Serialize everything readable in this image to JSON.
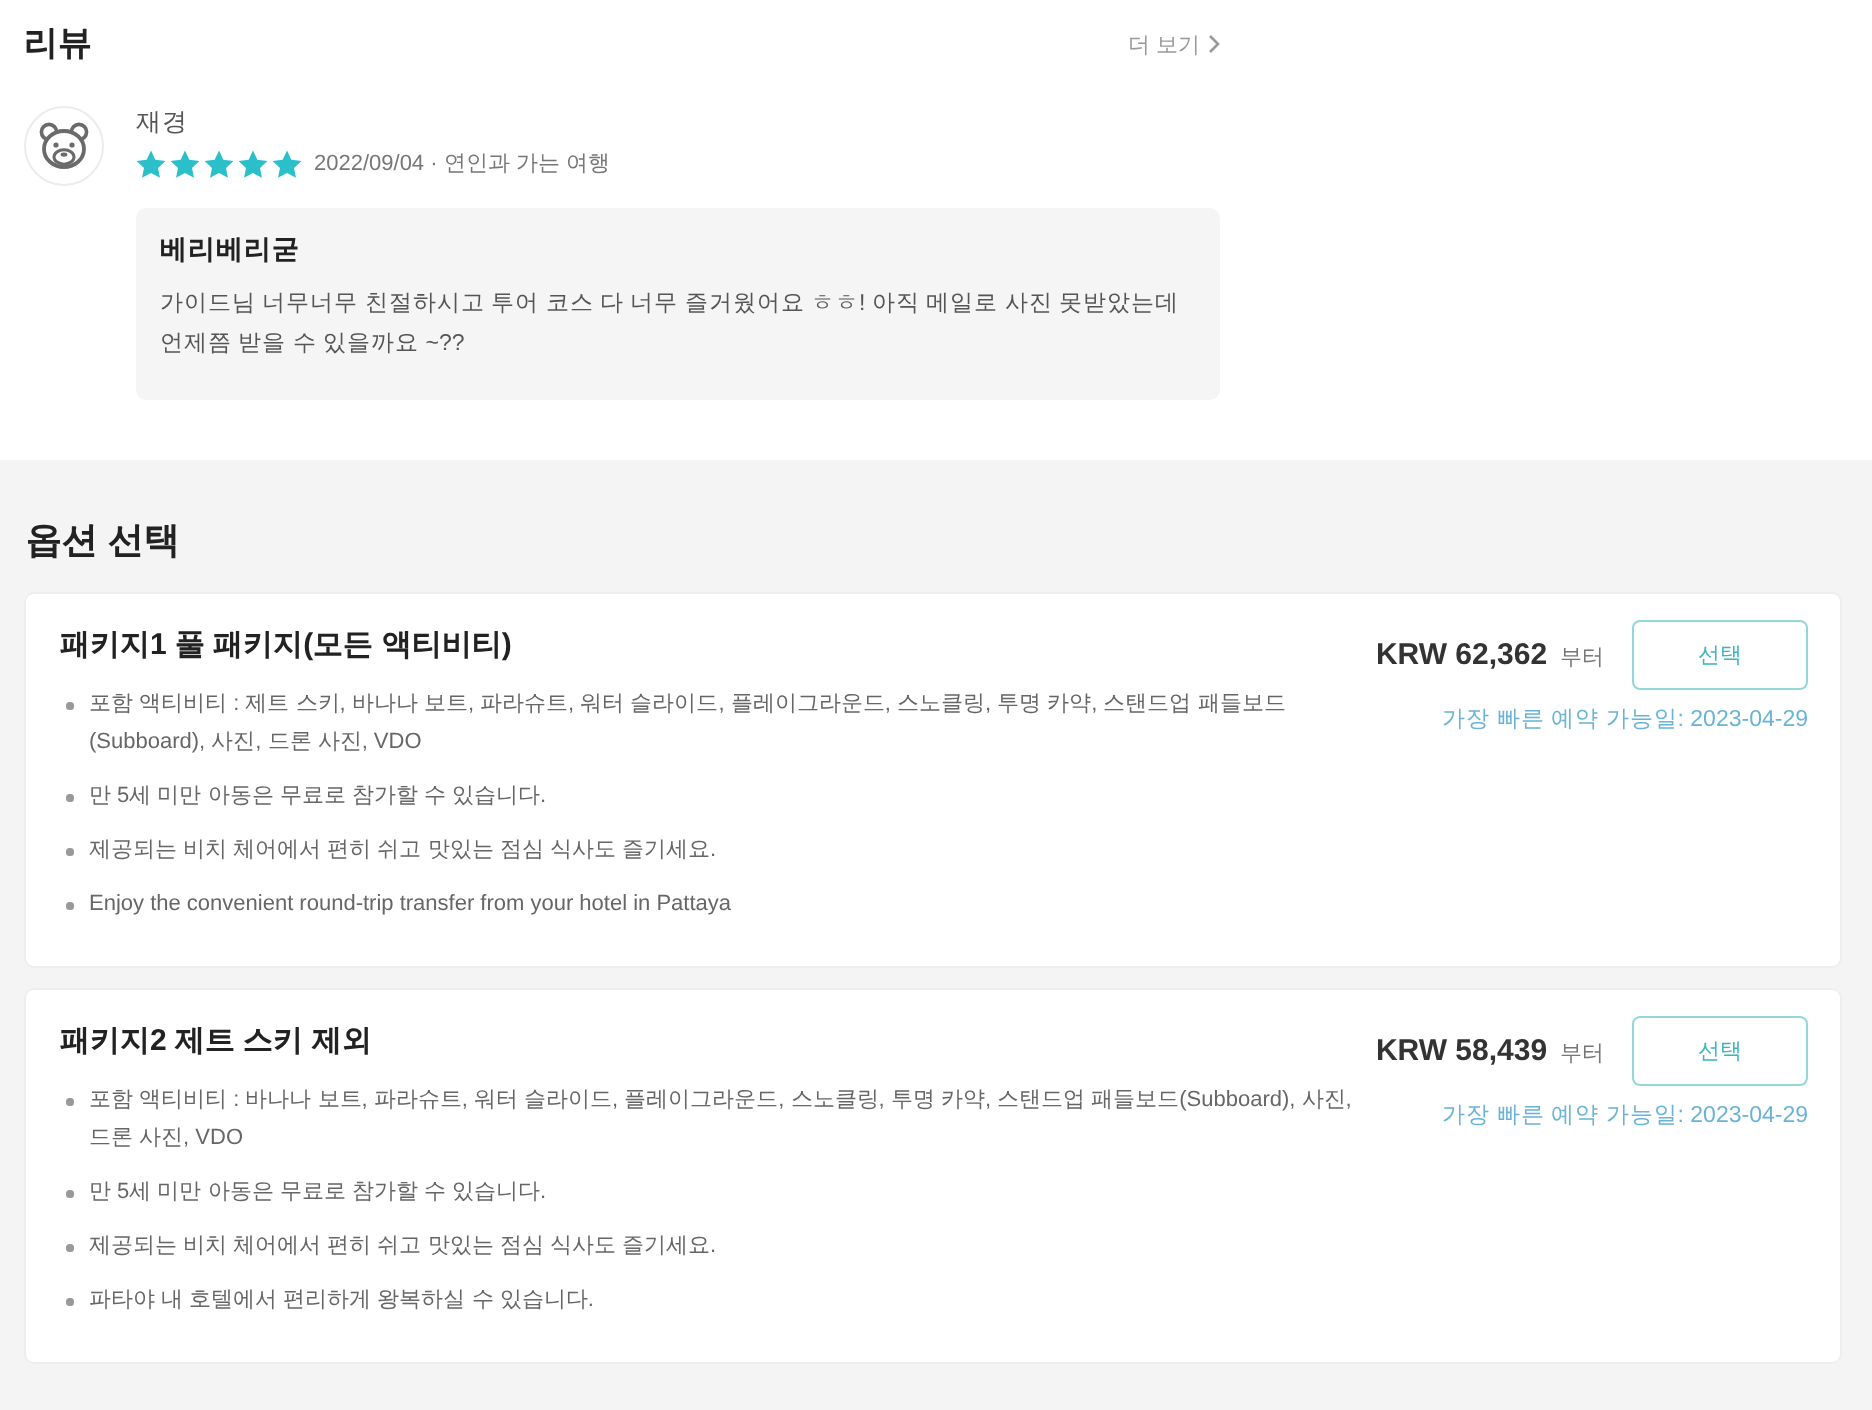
{
  "review_section": {
    "title": "리뷰",
    "more_link": "더 보기"
  },
  "reviews": [
    {
      "author": "재경",
      "stars": 5,
      "meta": "2022/09/04 · 연인과 가는 여행",
      "title": "베리베리굳",
      "body": "가이드님 너무너무 친절하시고 투어 코스 다 너무 즐거웠어요 ㅎㅎ! 아직 메일로 사진 못받았는데 언제쯤 받을 수 있을까요 ~??"
    }
  ],
  "option_section": {
    "title": "옵션 선택",
    "packages": [
      {
        "name": "패키지1 풀 패키지(모든 액티비티)",
        "features": [
          "포함 액티비티 : 제트 스키, 바나나 보트, 파라슈트, 워터 슬라이드, 플레이그라운드, 스노클링, 투명 카약, 스탠드업 패들보드(Subboard), 사진, 드론 사진, VDO",
          "만 5세 미만 아동은 무료로 참가할 수 있습니다.",
          "제공되는 비치 체어에서 편히 쉬고 맛있는 점심 식사도 즐기세요.",
          "Enjoy the convenient round-trip transfer from your hotel in Pattaya"
        ],
        "price": "KRW 62,362",
        "price_suffix": "부터",
        "button": "선택",
        "earliest_date": "가장 빠른 예약 가능일: 2023-04-29"
      },
      {
        "name": "패키지2 제트 스키 제외",
        "features": [
          "포함 액티비티 : 바나나 보트, 파라슈트, 워터 슬라이드, 플레이그라운드, 스노클링, 투명 카약, 스탠드업 패들보드(Subboard), 사진, 드론 사진, VDO",
          "만 5세 미만 아동은 무료로 참가할 수 있습니다.",
          "제공되는 비치 체어에서 편히 쉬고 맛있는 점심 식사도 즐기세요.",
          "파타야 내 호텔에서 편리하게 왕복하실 수 있습니다."
        ],
        "price": "KRW 58,439",
        "price_suffix": "부터",
        "button": "선택",
        "earliest_date": "가장 빠른 예약 가능일: 2023-04-29"
      }
    ]
  }
}
